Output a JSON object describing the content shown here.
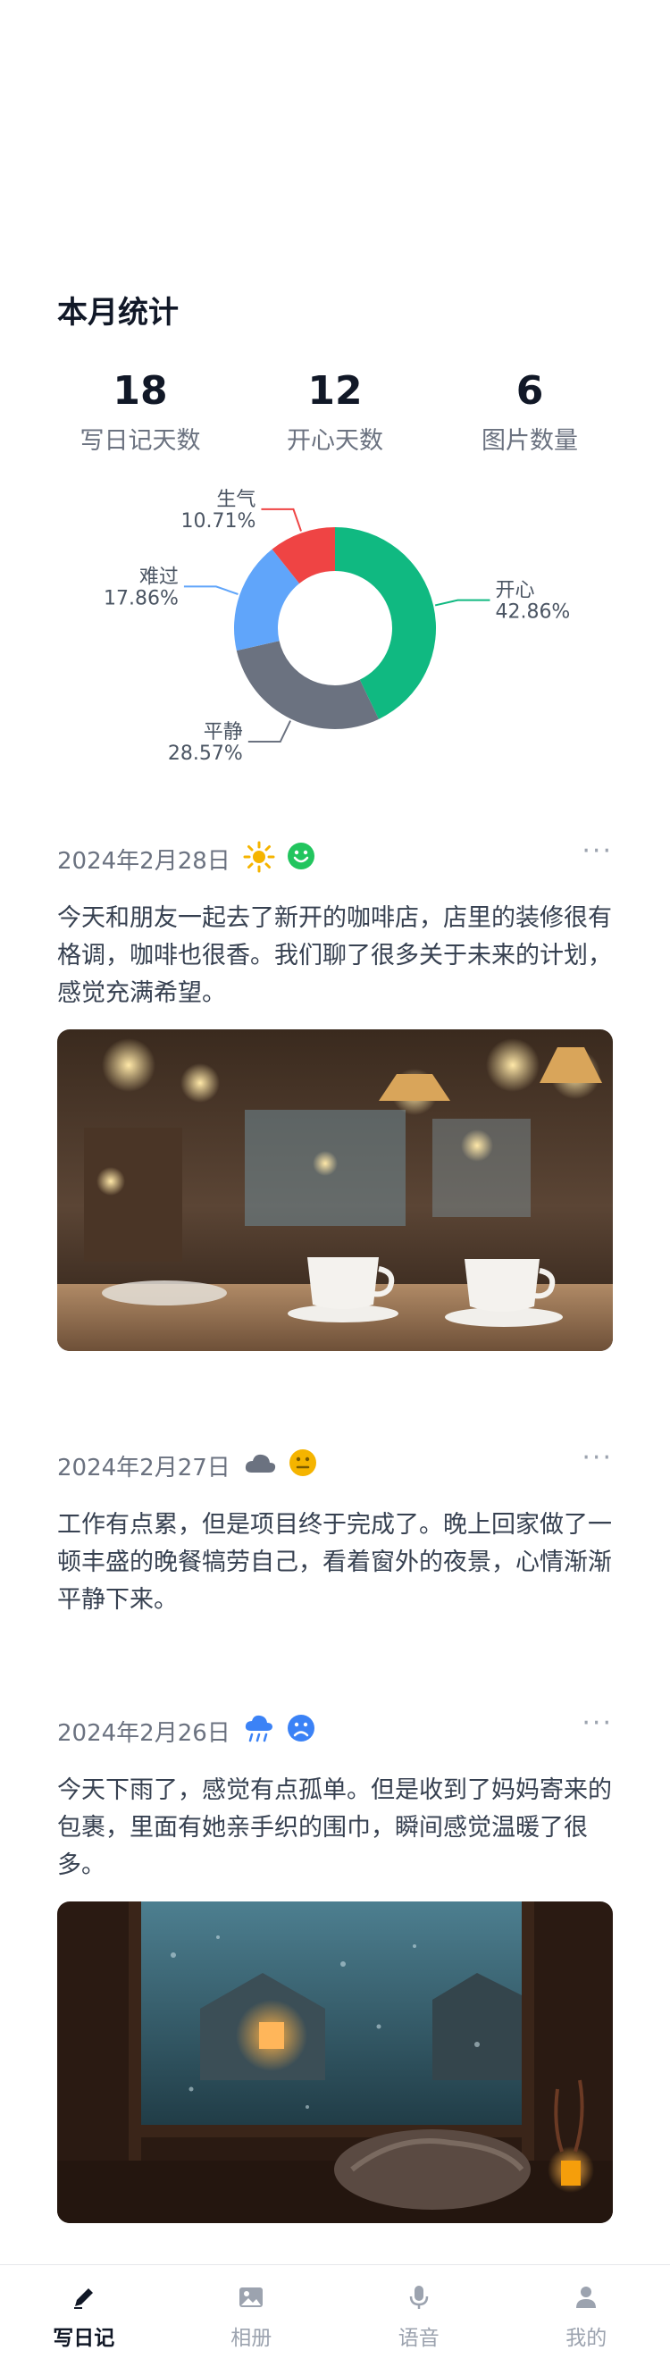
{
  "stats": {
    "title": "本月统计",
    "items": [
      {
        "value": "18",
        "label": "写日记天数"
      },
      {
        "value": "12",
        "label": "开心天数"
      },
      {
        "value": "6",
        "label": "图片数量"
      }
    ]
  },
  "chart_data": {
    "type": "pie",
    "donut": true,
    "slices": [
      {
        "label": "开心",
        "value": 42.86,
        "percent_label": "42.86%",
        "color": "#10b981"
      },
      {
        "label": "平静",
        "value": 28.57,
        "percent_label": "28.57%",
        "color": "#6b7280"
      },
      {
        "label": "难过",
        "value": 17.86,
        "percent_label": "17.86%",
        "color": "#60a5fa"
      },
      {
        "label": "生气",
        "value": 10.71,
        "percent_label": "10.71%",
        "color": "#ef4444"
      }
    ]
  },
  "entries": [
    {
      "date": "2024年2月28日",
      "weather_icon": "sun-icon",
      "mood_icon": "happy-face-icon",
      "more": "···",
      "text": "今天和朋友一起去了新开的咖啡店，店里的装修很有格调，咖啡也很香。我们聊了很多关于未来的计划，感觉充满希望。",
      "has_photo": true
    },
    {
      "date": "2024年2月27日",
      "weather_icon": "cloud-icon",
      "mood_icon": "neutral-face-icon",
      "more": "···",
      "text": "工作有点累，但是项目终于完成了。晚上回家做了一顿丰盛的晚餐犒劳自己，看着窗外的夜景，心情渐渐平静下来。",
      "has_photo": false
    },
    {
      "date": "2024年2月26日",
      "weather_icon": "rain-icon",
      "mood_icon": "sad-face-icon",
      "more": "···",
      "text": "今天下雨了，感觉有点孤单。但是收到了妈妈寄来的包裹，里面有她亲手织的围巾，瞬间感觉温暖了很多。",
      "has_photo": true
    }
  ],
  "tabbar": {
    "tabs": [
      {
        "label": "写日记",
        "icon": "pencil-icon",
        "active": true
      },
      {
        "label": "相册",
        "icon": "image-icon",
        "active": false
      },
      {
        "label": "语音",
        "icon": "microphone-icon",
        "active": false
      },
      {
        "label": "我的",
        "icon": "user-icon",
        "active": false
      }
    ]
  },
  "colors": {
    "accent_happy": "#10b981",
    "calm": "#6b7280",
    "sad": "#60a5fa",
    "angry": "#ef4444",
    "sun": "#f5b400",
    "neutral_face": "#f5b400",
    "sad_face": "#3b82f6"
  }
}
